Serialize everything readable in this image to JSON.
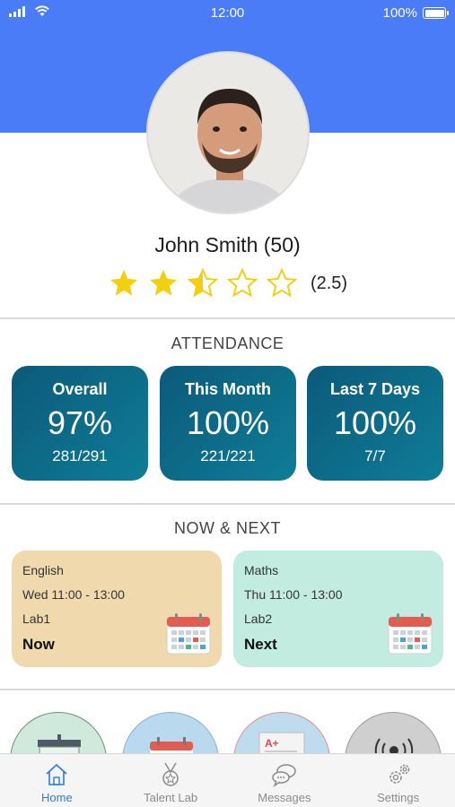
{
  "status_bar": {
    "time": "12:00",
    "battery": "100%"
  },
  "profile": {
    "name": "John Smith (50)",
    "rating": 2.5,
    "rating_text": "(2.5)"
  },
  "attendance": {
    "title": "ATTENDANCE",
    "cards": [
      {
        "label": "Overall",
        "percent": "97%",
        "ratio": "281/291"
      },
      {
        "label": "This Month",
        "percent": "100%",
        "ratio": "221/221"
      },
      {
        "label": "Last 7 Days",
        "percent": "100%",
        "ratio": "7/7"
      }
    ]
  },
  "now_next": {
    "title": "NOW & NEXT",
    "cards": [
      {
        "subject": "English",
        "time": "Wed 11:00 - 13:00",
        "room": "Lab1",
        "status": "Now",
        "color": "#f0d9ac"
      },
      {
        "subject": "Maths",
        "time": "Thu 11:00 - 13:00",
        "room": "Lab2",
        "status": "Next",
        "color": "#c2ecdf"
      }
    ]
  },
  "shortcuts": [
    {
      "icon": "whiteboard-icon",
      "color": "#cfe9dc"
    },
    {
      "icon": "calendar-icon",
      "color": "#b9d9ee"
    },
    {
      "icon": "grade-report-icon",
      "color": "#bfdcef"
    },
    {
      "icon": "nfc-reader-icon",
      "color": "#cfcfcf"
    }
  ],
  "tabbar": {
    "items": [
      {
        "label": "Home",
        "icon": "home-icon",
        "active": true
      },
      {
        "label": "Talent Lab",
        "icon": "medal-icon",
        "active": false
      },
      {
        "label": "Messages",
        "icon": "chat-icon",
        "active": false
      },
      {
        "label": "Settings",
        "icon": "gears-icon",
        "active": false
      }
    ]
  },
  "colors": {
    "header": "#4a7cf7",
    "accent": "#2f7bd8",
    "attendance_card": "#0e6d8a",
    "star": "#f2cf0f"
  }
}
